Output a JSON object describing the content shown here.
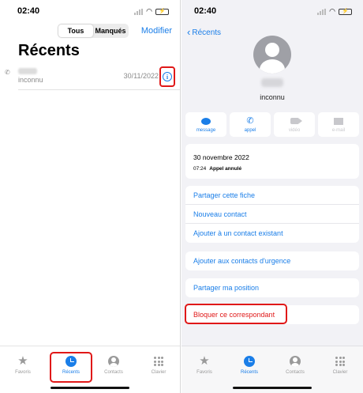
{
  "left": {
    "status": {
      "time": "02:40",
      "battery_icon": "battery-charging-icon"
    },
    "segment": {
      "all": "Tous",
      "missed": "Manqués"
    },
    "edit": "Modifier",
    "title": "Récents",
    "recent": {
      "caller": "inconnu",
      "date": "30/11/2022",
      "info_icon": "info-icon"
    },
    "tabs": [
      {
        "label": "Favoris",
        "icon": "star-icon"
      },
      {
        "label": "Récents",
        "icon": "clock-icon"
      },
      {
        "label": "Contacts",
        "icon": "person-circle-icon"
      },
      {
        "label": "Clavier",
        "icon": "keypad-icon"
      }
    ]
  },
  "right": {
    "status": {
      "time": "02:40"
    },
    "back": "Récents",
    "contact": {
      "subtitle": "inconnu"
    },
    "actions": [
      {
        "label": "message",
        "icon": "message-bubble-icon",
        "enabled": true
      },
      {
        "label": "appel",
        "icon": "phone-icon",
        "enabled": true
      },
      {
        "label": "vidéo",
        "icon": "video-icon",
        "enabled": false
      },
      {
        "label": "e-mail",
        "icon": "mail-icon",
        "enabled": false
      }
    ],
    "history": {
      "date": "30 novembre 2022",
      "time": "07:24",
      "status": "Appel annulé"
    },
    "options": {
      "share": "Partager cette fiche",
      "new": "Nouveau contact",
      "add_existing": "Ajouter à un contact existant",
      "emergency": "Ajouter aux contacts d'urgence",
      "share_location": "Partager ma position",
      "block": "Bloquer ce correspondant"
    },
    "tabs": [
      {
        "label": "Favoris"
      },
      {
        "label": "Récents"
      },
      {
        "label": "Contacts"
      },
      {
        "label": "Clavier"
      }
    ]
  },
  "colors": {
    "accent": "#1a7ee8",
    "danger": "#e01818",
    "highlight": "#e01818"
  }
}
